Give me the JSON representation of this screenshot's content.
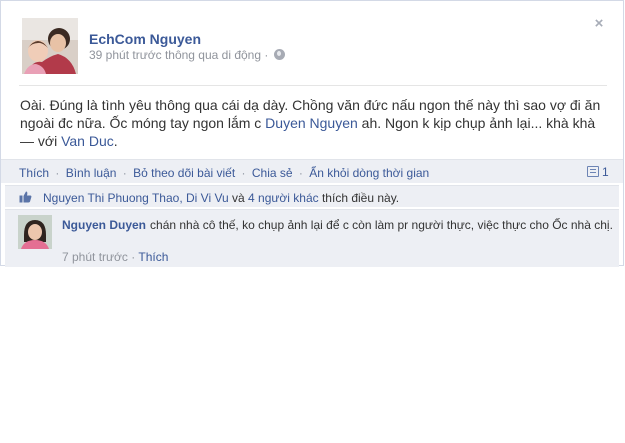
{
  "post": {
    "author": "EchCom Nguyen",
    "meta": "39 phút trước thông qua di động ·",
    "close_glyph": "×",
    "message_start": "Oài. Đúng là tình yêu thông qua cái dạ dày. Chồng văn đức nấu ngon thế này thì sao vợ đi ăn ngoài đc nữa. Ốc móng tay ngon lắm c ",
    "mention": "Duyen Nguyen",
    "message_end": " ah. Ngon k kịp chụp ảnh lại... khà khà",
    "with_prefix": " — với ",
    "with_name": "Van Duc",
    "with_suffix": "."
  },
  "actions": {
    "like": "Thích",
    "comment": "Bình luận",
    "unfollow": "Bỏ theo dõi bài viết",
    "share": "Chia sẻ",
    "hide": "Ẩn khỏi dòng thời gian",
    "separator": "·",
    "comment_count": "1"
  },
  "likes": {
    "people": "Nguyen Thi Phuong Thao, Di Vi Vu",
    "conj": " và ",
    "others": "4 người khác",
    "suffix": " thích điều này."
  },
  "comment": {
    "author": "Nguyen Duyen",
    "text": "chán nhà cô thế, ko chụp ảnh lại để c còn làm pr người thực, việc thực cho Ốc nhà chị.",
    "time": "7 phút trước",
    "separator": " · ",
    "like": "Thích"
  },
  "icons": {
    "close": "close-icon",
    "globe": "globe-icon",
    "comments": "comment-bubble-icon",
    "thumb": "thumbs-up-icon"
  },
  "colors": {
    "link": "#3b5998",
    "meta": "#90949c",
    "ufi_bg": "#edeff4",
    "border": "#d3d9e6"
  }
}
